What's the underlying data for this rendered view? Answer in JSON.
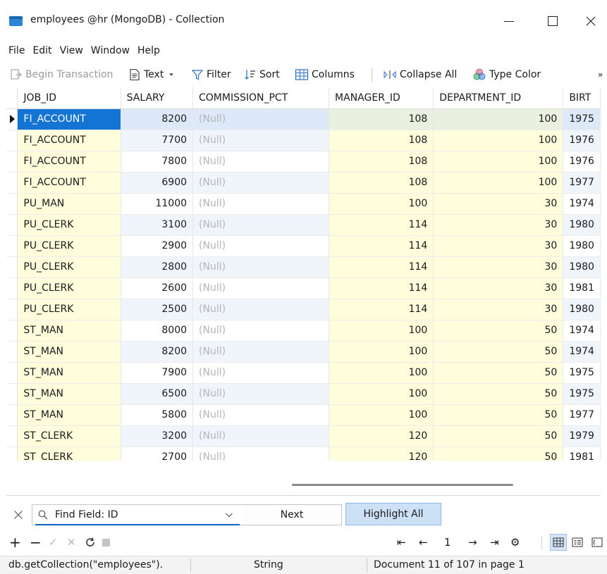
{
  "window": {
    "title": "employees @hr (MongoDB) - Collection",
    "minimize_icon": "minimize-icon",
    "maximize_icon": "maximize-icon",
    "close_icon": "close-icon"
  },
  "menu": [
    "File",
    "Edit",
    "View",
    "Window",
    "Help"
  ],
  "toolbar": {
    "begin_transaction": "Begin Transaction",
    "text": "Text",
    "filter": "Filter",
    "sort": "Sort",
    "columns": "Columns",
    "collapse_all": "Collapse All",
    "type_color": "Type Color",
    "overflow": "»"
  },
  "grid": {
    "columns": [
      "JOB_ID",
      "SALARY",
      "COMMISSION_PCT",
      "MANAGER_ID",
      "DEPARTMENT_ID",
      "BIRT"
    ],
    "rows": [
      {
        "job": "FI_ACCOUNT",
        "salary": "8200",
        "commission": "(Null)",
        "manager": "108",
        "dept": "100",
        "birth": "1975"
      },
      {
        "job": "FI_ACCOUNT",
        "salary": "7700",
        "commission": "(Null)",
        "manager": "108",
        "dept": "100",
        "birth": "1976"
      },
      {
        "job": "FI_ACCOUNT",
        "salary": "7800",
        "commission": "(Null)",
        "manager": "108",
        "dept": "100",
        "birth": "1976"
      },
      {
        "job": "FI_ACCOUNT",
        "salary": "6900",
        "commission": "(Null)",
        "manager": "108",
        "dept": "100",
        "birth": "1977"
      },
      {
        "job": "PU_MAN",
        "salary": "11000",
        "commission": "(Null)",
        "manager": "100",
        "dept": "30",
        "birth": "1974"
      },
      {
        "job": "PU_CLERK",
        "salary": "3100",
        "commission": "(Null)",
        "manager": "114",
        "dept": "30",
        "birth": "1980"
      },
      {
        "job": "PU_CLERK",
        "salary": "2900",
        "commission": "(Null)",
        "manager": "114",
        "dept": "30",
        "birth": "1980"
      },
      {
        "job": "PU_CLERK",
        "salary": "2800",
        "commission": "(Null)",
        "manager": "114",
        "dept": "30",
        "birth": "1980"
      },
      {
        "job": "PU_CLERK",
        "salary": "2600",
        "commission": "(Null)",
        "manager": "114",
        "dept": "30",
        "birth": "1981"
      },
      {
        "job": "PU_CLERK",
        "salary": "2500",
        "commission": "(Null)",
        "manager": "114",
        "dept": "30",
        "birth": "1980"
      },
      {
        "job": "ST_MAN",
        "salary": "8000",
        "commission": "(Null)",
        "manager": "100",
        "dept": "50",
        "birth": "1974"
      },
      {
        "job": "ST_MAN",
        "salary": "8200",
        "commission": "(Null)",
        "manager": "100",
        "dept": "50",
        "birth": "1974"
      },
      {
        "job": "ST_MAN",
        "salary": "7900",
        "commission": "(Null)",
        "manager": "100",
        "dept": "50",
        "birth": "1975"
      },
      {
        "job": "ST_MAN",
        "salary": "6500",
        "commission": "(Null)",
        "manager": "100",
        "dept": "50",
        "birth": "1975"
      },
      {
        "job": "ST_MAN",
        "salary": "5800",
        "commission": "(Null)",
        "manager": "100",
        "dept": "50",
        "birth": "1977"
      },
      {
        "job": "ST_CLERK",
        "salary": "3200",
        "commission": "(Null)",
        "manager": "120",
        "dept": "50",
        "birth": "1979"
      },
      {
        "job": "ST_CLERK",
        "salary": "2700",
        "commission": "(Null)",
        "manager": "120",
        "dept": "50",
        "birth": "1981"
      }
    ],
    "selected_row": 0
  },
  "find": {
    "field": "Find Field: ID",
    "next": "Next",
    "highlight_all": "Highlight All"
  },
  "nav": {
    "page": "1"
  },
  "status": {
    "query": "db.getCollection(\"employees\").",
    "type": "String",
    "position": "Document 11 of 107 in page 1"
  },
  "colors": {
    "selection": "#1474d4",
    "key_column": "#fefedd",
    "highlight_button": "#cce0f6"
  }
}
